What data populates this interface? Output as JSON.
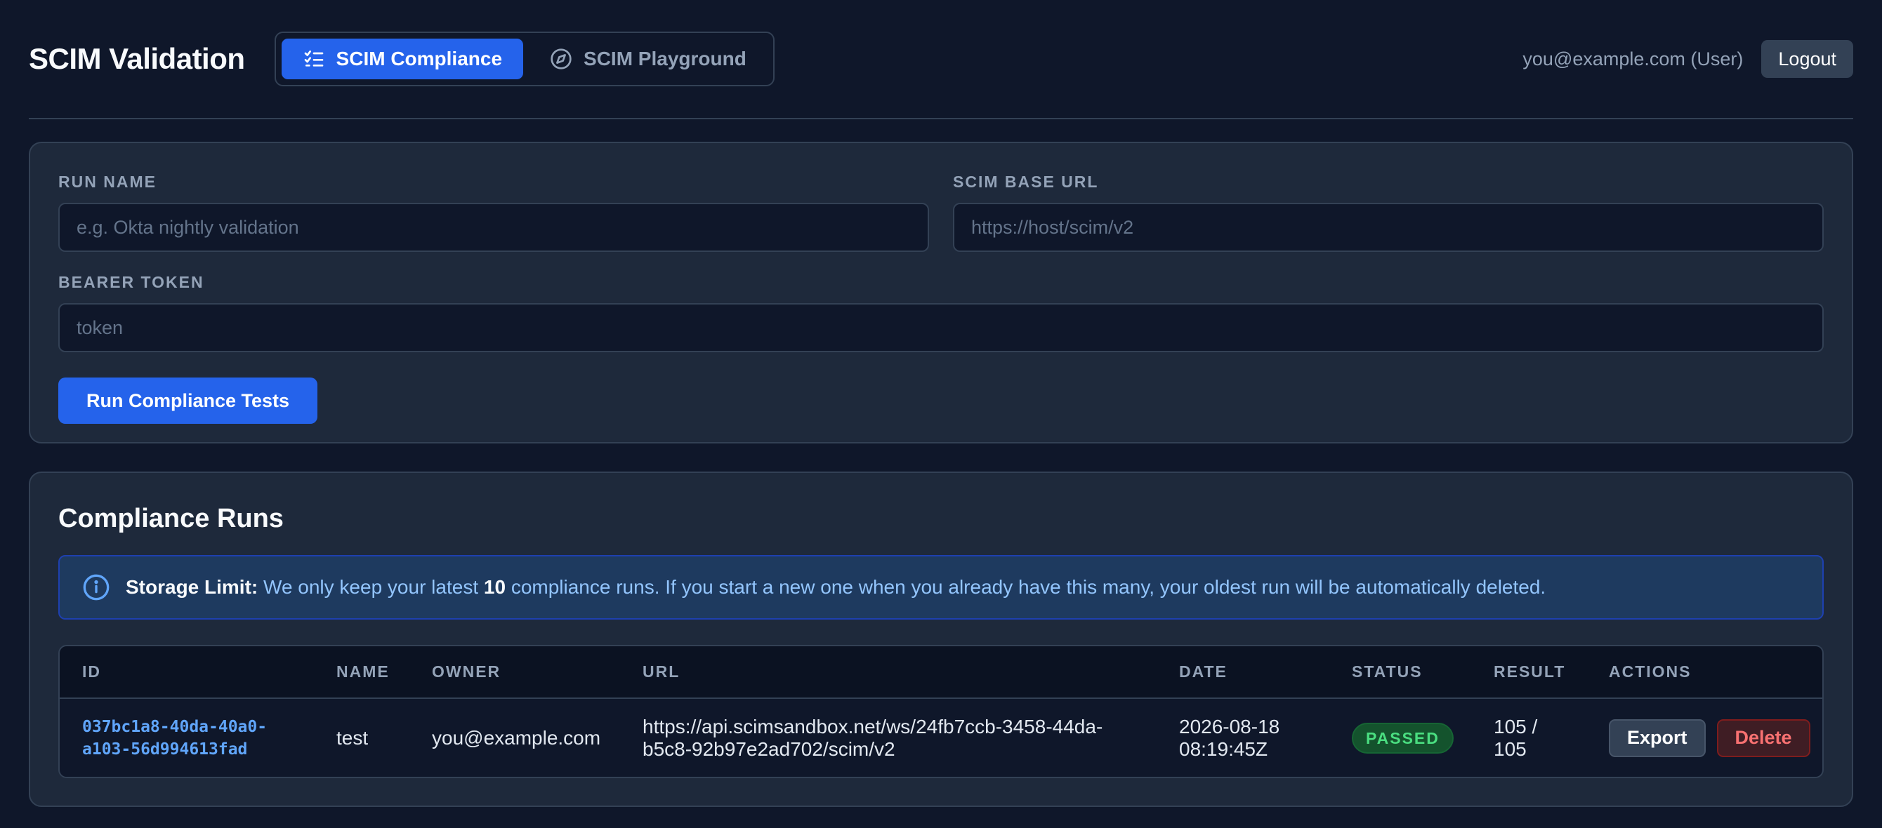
{
  "app": {
    "title": "SCIM Validation"
  },
  "tabs": [
    {
      "label": "SCIM Compliance",
      "icon": "checklist-icon",
      "active": true
    },
    {
      "label": "SCIM Playground",
      "icon": "compass-icon",
      "active": false
    }
  ],
  "user": {
    "label": "you@example.com (User)",
    "logout_label": "Logout"
  },
  "form": {
    "run_name": {
      "label": "RUN NAME",
      "placeholder": "e.g. Okta nightly validation",
      "value": ""
    },
    "base_url": {
      "label": "SCIM BASE URL",
      "placeholder": "https://host/scim/v2",
      "value": ""
    },
    "token": {
      "label": "BEARER TOKEN",
      "placeholder": "token",
      "value": ""
    },
    "submit_label": "Run Compliance Tests"
  },
  "runs": {
    "title": "Compliance Runs",
    "notice": {
      "strong": "Storage Limit:",
      "text_before": "We only keep your latest",
      "limit": "10",
      "text_after": "compliance runs. If you start a new one when you already have this many, your oldest run will be automatically deleted."
    },
    "columns": [
      "ID",
      "NAME",
      "OWNER",
      "URL",
      "DATE",
      "STATUS",
      "RESULT",
      "ACTIONS"
    ],
    "rows": [
      {
        "id_line1": "037bc1a8-40da-40a0-",
        "id_line2": "a103-56d994613fad",
        "name": "test",
        "owner": "you@example.com",
        "url_line1": "https://api.scimsandbox.net/ws/24fb7ccb-3458-44da-",
        "url_line2": "b5c8-92b97e2ad702/scim/v2",
        "date_line1": "2026-08-18",
        "date_line2": "08:19:45Z",
        "status": "PASSED",
        "result_line1": "105 /",
        "result_line2": "105",
        "export_label": "Export",
        "delete_label": "Delete"
      }
    ]
  },
  "colors": {
    "background": "#0f172a",
    "card": "#1e293b",
    "accent": "#2563eb",
    "success": "#4ade80",
    "danger": "#f87171",
    "link": "#60a5fa"
  }
}
